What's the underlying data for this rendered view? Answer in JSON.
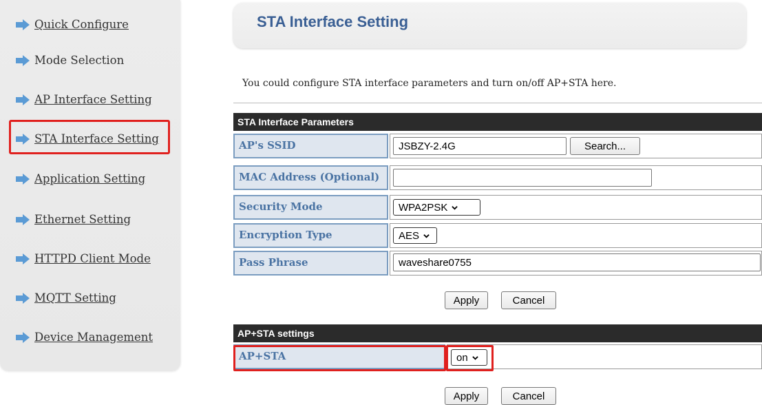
{
  "sidebar": {
    "items": [
      {
        "label": "Quick Configure"
      },
      {
        "label": "Mode Selection"
      },
      {
        "label": "AP Interface Setting"
      },
      {
        "label": "STA Interface Setting"
      },
      {
        "label": "Application Setting"
      },
      {
        "label": "Ethernet Setting"
      },
      {
        "label": "HTTPD Client Mode"
      },
      {
        "label": "MQTT Setting"
      },
      {
        "label": "Device Management"
      }
    ],
    "selected_index": 3
  },
  "page": {
    "title": "STA Interface Setting",
    "description": "You could configure STA interface parameters and turn on/off AP+STA here."
  },
  "sta_params": {
    "header": "STA Interface Parameters",
    "ssid": {
      "label": "AP's SSID",
      "value": "JSBZY-2.4G",
      "search_label": "Search..."
    },
    "mac": {
      "label": "MAC Address (Optional)",
      "value": ""
    },
    "security": {
      "label": "Security Mode",
      "value": "WPA2PSK"
    },
    "encryption": {
      "label": "Encryption Type",
      "value": "AES"
    },
    "pass": {
      "label": "Pass Phrase",
      "value": "waveshare0755"
    },
    "apply_label": "Apply",
    "cancel_label": "Cancel"
  },
  "apsta": {
    "header": "AP+STA settings",
    "label": "AP+STA",
    "value": "on",
    "apply_label": "Apply",
    "cancel_label": "Cancel"
  },
  "colors": {
    "accent_title": "#3a5f94",
    "label_text": "#4a73a3",
    "label_bg": "#dfe6ef",
    "highlight": "#e0201e",
    "header_bg": "#2b2b2b"
  },
  "icons": {
    "nav": "arrow-right-icon",
    "dropdown": "chevron-down-icon"
  }
}
